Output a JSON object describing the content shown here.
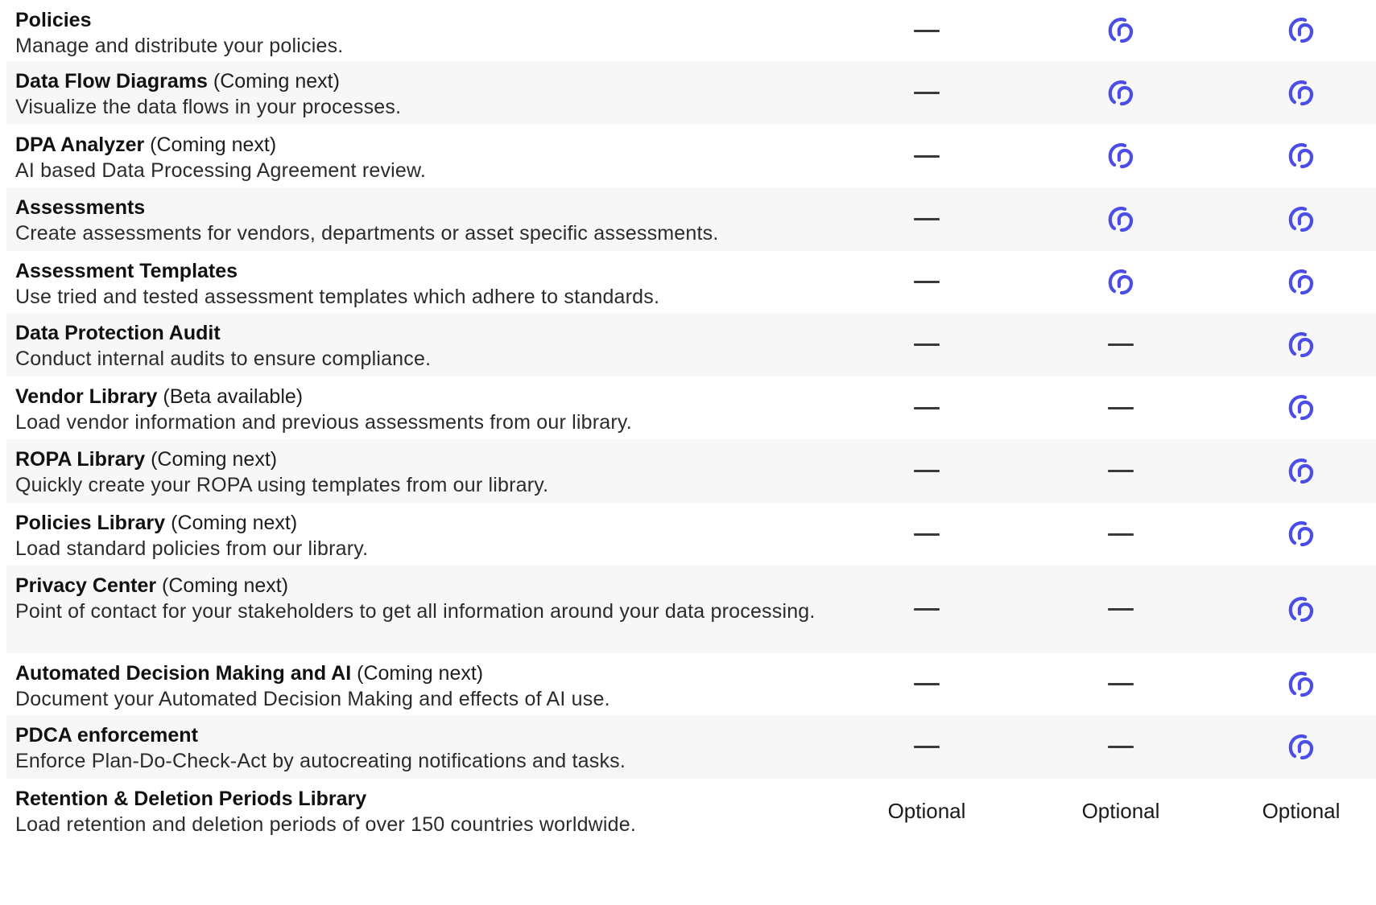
{
  "colors": {
    "brand_icon": "#4b4de6",
    "row_alt": "#f7f7f7",
    "dash": "#3a3a3a"
  },
  "icons": {
    "included": "included-logo-icon",
    "not_included": "dash-icon"
  },
  "rows": [
    {
      "title": "Policies",
      "note": "",
      "desc": "Manage and distribute your policies.",
      "cells": [
        "dash",
        "check",
        "check"
      ]
    },
    {
      "title": "Data Flow Diagrams",
      "note": " (Coming next)",
      "desc": "Visualize the data flows in your processes.",
      "cells": [
        "dash",
        "check",
        "check"
      ]
    },
    {
      "title": "DPA Analyzer",
      "note": " (Coming next)",
      "desc": "AI based Data Processing Agreement review.",
      "cells": [
        "dash",
        "check",
        "check"
      ]
    },
    {
      "title": "Assessments",
      "note": "",
      "desc": "Create assessments for vendors, departments or asset specific assessments.",
      "cells": [
        "dash",
        "check",
        "check"
      ]
    },
    {
      "title": "Assessment Templates",
      "note": "",
      "desc": "Use tried and tested assessment templates which adhere to standards.",
      "cells": [
        "dash",
        "check",
        "check"
      ]
    },
    {
      "title": "Data Protection Audit",
      "note": "",
      "desc": "Conduct internal audits to ensure compliance.",
      "cells": [
        "dash",
        "dash",
        "check"
      ]
    },
    {
      "title": "Vendor Library",
      "note": " (Beta available)",
      "desc": "Load vendor information and previous assessments from our library.",
      "cells": [
        "dash",
        "dash",
        "check"
      ]
    },
    {
      "title": "ROPA Library",
      "note": " (Coming next)",
      "desc": "Quickly create your ROPA using templates from our library.",
      "cells": [
        "dash",
        "dash",
        "check"
      ]
    },
    {
      "title": "Policies Library",
      "note": " (Coming next)",
      "desc": "Load standard policies from our library.",
      "cells": [
        "dash",
        "dash",
        "check"
      ]
    },
    {
      "title": "Privacy Center",
      "note": " (Coming next)",
      "desc": "Point of contact for your stakeholders to get all information around your data processing.",
      "cells": [
        "dash",
        "dash",
        "check"
      ]
    },
    {
      "title": "Automated Decision Making and AI",
      "note": " (Coming next)",
      "desc": "Document your Automated Decision Making and effects of AI use.",
      "cells": [
        "dash",
        "dash",
        "check"
      ]
    },
    {
      "title": "PDCA enforcement",
      "note": "",
      "desc": "Enforce Plan-Do-Check-Act by autocreating notifications and tasks.",
      "cells": [
        "dash",
        "dash",
        "check"
      ]
    },
    {
      "title": "Retention & Deletion Periods Library",
      "note": "",
      "desc": "Load retention and deletion periods of over 150 countries worldwide.",
      "cells": [
        "Optional",
        "Optional",
        "Optional"
      ]
    }
  ]
}
